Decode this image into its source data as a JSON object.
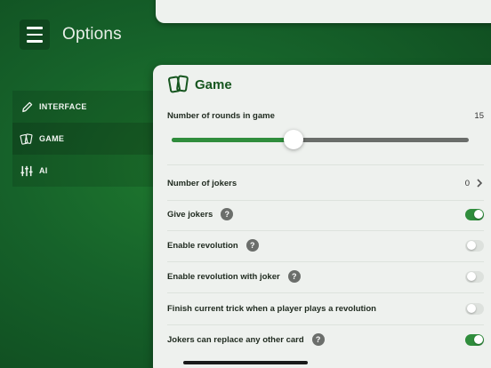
{
  "app": {
    "title": "Options"
  },
  "sidebar": {
    "items": [
      {
        "label": "INTERFACE",
        "icon": "pencil-icon"
      },
      {
        "label": "GAME",
        "icon": "cards-icon"
      },
      {
        "label": "AI",
        "icon": "sliders-icon"
      }
    ],
    "active_index": 1
  },
  "panel": {
    "title": "Game",
    "icon": "cards-icon",
    "rounds": {
      "label": "Number of rounds in game",
      "value": "15",
      "slider_fraction": 0.41
    },
    "jokers": {
      "label": "Number of jokers",
      "value": "0"
    },
    "settings": [
      {
        "label": "Give jokers",
        "help": "?",
        "on": true
      },
      {
        "label": "Enable revolution",
        "help": "?",
        "on": false
      },
      {
        "label": "Enable revolution with joker",
        "help": "?",
        "on": false
      },
      {
        "label": "Finish current trick when a player plays a revolution",
        "help": "",
        "on": false
      },
      {
        "label": "Jokers can replace any other card",
        "help": "?",
        "on": true
      }
    ]
  },
  "colors": {
    "accent": "#2f8d3c",
    "background": "#16622a",
    "panel": "#eef1ee",
    "title": "#16561f"
  }
}
